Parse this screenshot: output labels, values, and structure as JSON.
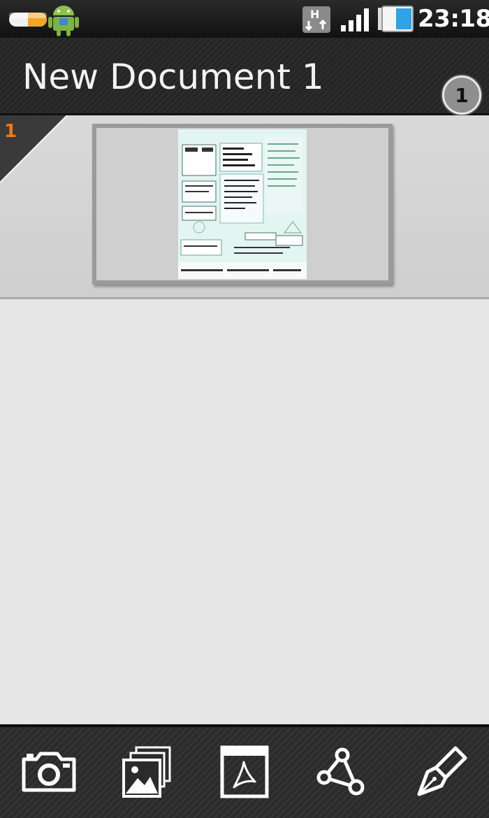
{
  "status_bar": {
    "time": "23:18",
    "network_label": "H",
    "icons": [
      "capsule-icon",
      "android-robot-icon",
      "hspa-data-icon",
      "signal-strength-icon",
      "battery-icon"
    ],
    "battery_color": "#2ea3e6"
  },
  "header": {
    "title": "New Document 1",
    "page_count": "1"
  },
  "pages": [
    {
      "number": "1",
      "selected": true
    }
  ],
  "toolbar": {
    "buttons": [
      {
        "icon": "camera-icon"
      },
      {
        "icon": "gallery-icon"
      },
      {
        "icon": "pdf-icon"
      },
      {
        "icon": "share-icon"
      },
      {
        "icon": "pen-icon"
      }
    ]
  },
  "colors": {
    "accent": "#f07a12",
    "background": "#e6e6e6",
    "bar": "#252525"
  }
}
